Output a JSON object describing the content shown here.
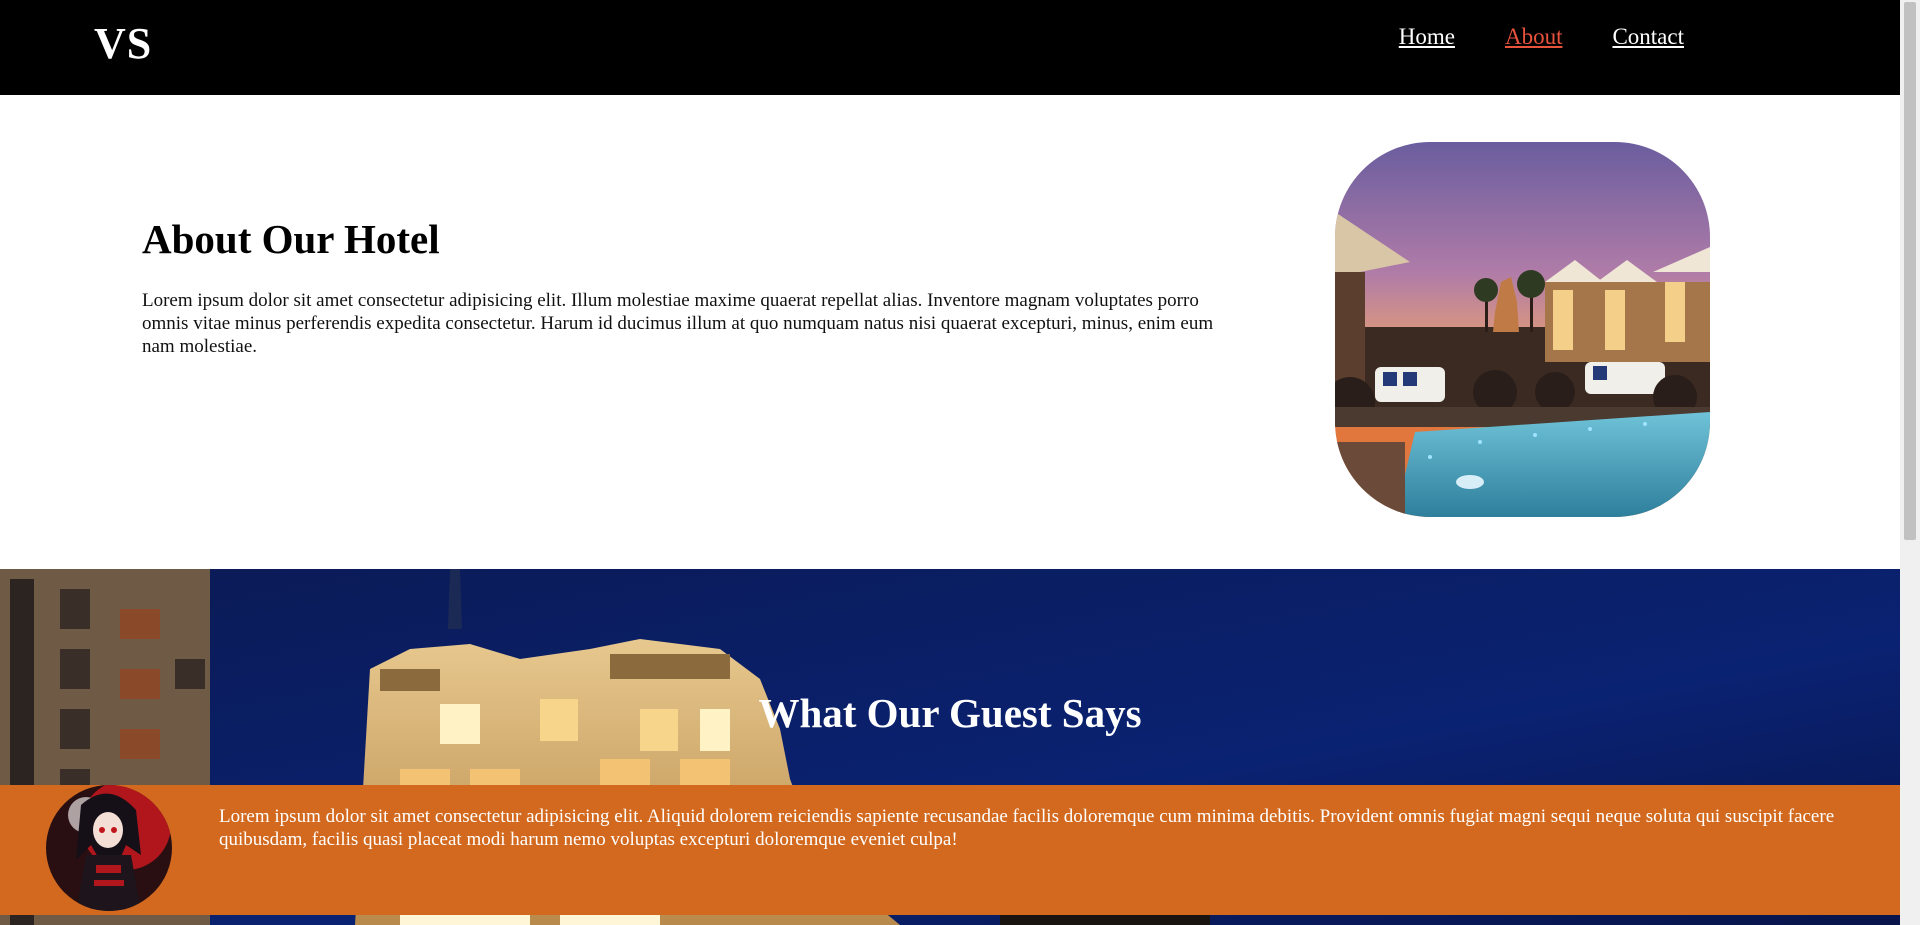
{
  "header": {
    "logo": "VS",
    "nav": [
      {
        "label": "Home",
        "active": false
      },
      {
        "label": "About",
        "active": true
      },
      {
        "label": "Contact",
        "active": false
      }
    ],
    "active_color": "#e8533c"
  },
  "about": {
    "title": "About Our Hotel",
    "text": "Lorem ipsum dolor sit amet consectetur adipisicing elit. Illum molestiae maxime quaerat repellat alias. Inventore magnam voluptates porro omnis vitae minus perferendis expedita consectetur. Harum id ducimus illum at quo numquam natus nisi quaerat excepturi, minus, enim eum nam molestiae."
  },
  "guest": {
    "title": "What Our Guest Says",
    "testimonial_text": "Lorem ipsum dolor sit amet consectetur adipisicing elit. Aliquid dolorem reiciendis sapiente recusandae facilis doloremque cum minima debitis. Provident omnis fugiat magni sequi neque soluta qui suscipit facere quibusdam, facilis quasi placeat modi harum nemo voluptas excepturi doloremque eveniet culpa!",
    "band_color": "#d2691e"
  }
}
